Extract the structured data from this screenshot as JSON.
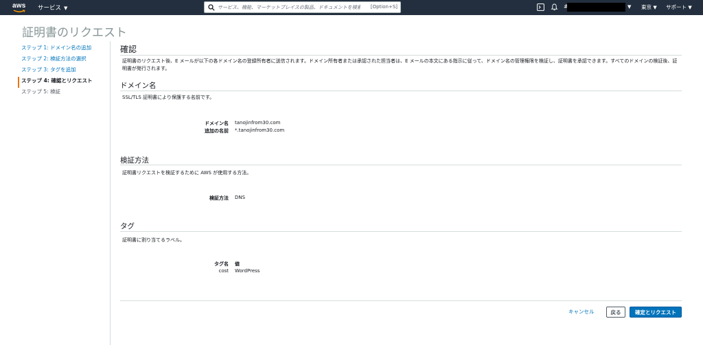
{
  "topbar": {
    "logo_text": "aws",
    "services_label": "サービス",
    "search_placeholder": "サービス、機能、マーケットプレイスの製品、ドキュメントを検索",
    "search_shortcut": "[Option+S]",
    "account_prefix": "#",
    "region_label": "東京",
    "support_label": "サポート",
    "icons": [
      "aws-logo",
      "search-icon",
      "cloudshell-icon",
      "bell-icon"
    ]
  },
  "page": {
    "title": "証明書のリクエスト"
  },
  "steps": [
    {
      "label": "ステップ 1: ドメイン名の追加",
      "state": "link"
    },
    {
      "label": "ステップ 2: 検証方法の選択",
      "state": "link"
    },
    {
      "label": "ステップ 3: タグを追加",
      "state": "link"
    },
    {
      "label": "ステップ 4: 確認とリクエスト",
      "state": "active"
    },
    {
      "label": "ステップ 5: 検証",
      "state": "future"
    }
  ],
  "review": {
    "title": "確認",
    "description": "証明書のリクエスト後、E メールが以下の各ドメイン名の登録所有者に送信されます。ドメイン所有者または承認された担当者は、E メールの本文にある指示に従って、ドメイン名の管理権限を検証し、証明書を承認できます。すべてのドメインの検証後、証明書が発行されます。"
  },
  "domains": {
    "title": "ドメイン名",
    "description": "SSL/TLS 証明書により保護する名前です。",
    "domain_key": "ドメイン名",
    "domain_value": "tanojinfrom30.com",
    "additional_key": "追加の名前",
    "additional_value": "*.tanojinfrom30.com"
  },
  "validation": {
    "title": "検証方法",
    "description": "証明書リクエストを検証するために AWS が使用する方法。",
    "method_key": "検証方法",
    "method_value": "DNS"
  },
  "tags": {
    "title": "タグ",
    "description": "証明書に割り当てるラベル。",
    "col_name": "タグ名",
    "col_value": "値",
    "rows": [
      {
        "name": "cost",
        "value": "WordPress"
      }
    ]
  },
  "actions": {
    "cancel": "キャンセル",
    "back": "戻る",
    "confirm": "確定とリクエスト"
  },
  "colors": {
    "nav_bg": "#232f3e",
    "accent_orange": "#ec7211",
    "link_blue": "#0073bb",
    "primary_button": "#0073bb"
  }
}
